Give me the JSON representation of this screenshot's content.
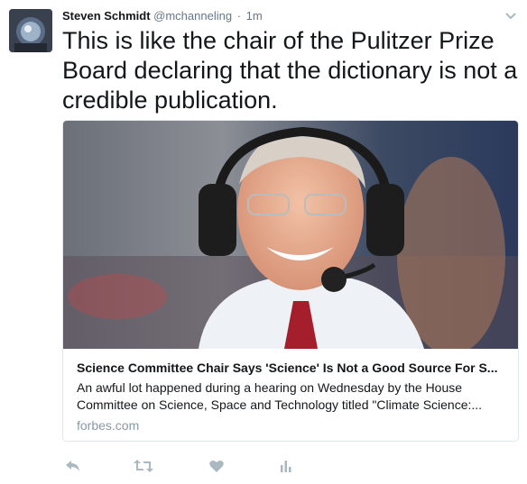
{
  "tweet": {
    "author_name": "Steven Schmidt",
    "handle": "@mchanneling",
    "separator": "·",
    "time": "1m",
    "text": "This is like the chair of the Pulitzer Prize Board declaring that the dictionary is not a credible publication."
  },
  "card": {
    "title": "Science Committee Chair Says 'Science' Is Not a Good Source For S...",
    "description_line1": "An awful lot happened during a hearing on Wednesday by the House",
    "description_line2": "Committee on Science, Space and Technology titled \"Climate Science:...",
    "domain": "forbes.com"
  },
  "actions": {
    "reply_icon": "reply-icon",
    "retweet_icon": "retweet-icon",
    "like_icon": "heart-icon",
    "analytics_icon": "analytics-icon"
  },
  "colors": {
    "text": "#14171a",
    "muted": "#657786",
    "icon": "#aab8c2",
    "border": "#e1e8ed"
  }
}
